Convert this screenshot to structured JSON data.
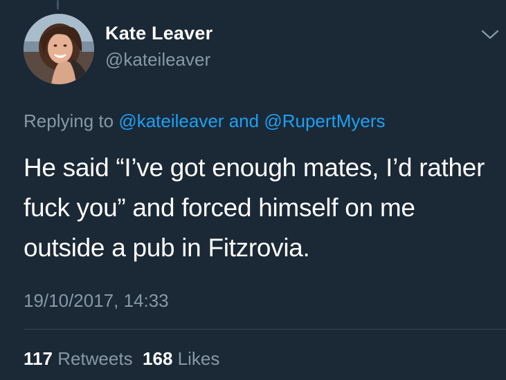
{
  "author": {
    "name": "Kate Leaver",
    "handle": "@kateileaver",
    "avatar_icon": "profile-photo"
  },
  "reply": {
    "prefix": "Replying to",
    "mention_1": "@kateileaver",
    "conjunction": "and",
    "mention_2": "@RupertMyers"
  },
  "tweet": {
    "text": "He said “I’ve got enough mates, I’d rather fuck you” and forced himself on me outside a pub in Fitzrovia.",
    "timestamp": "19/10/2017, 14:33"
  },
  "stats": {
    "retweets_count": "117",
    "retweets_label": "Retweets",
    "likes_count": "168",
    "likes_label": "Likes"
  },
  "colors": {
    "background": "#1b2836",
    "text": "#ffffff",
    "secondary": "#8899a6",
    "link": "#1da1f2",
    "divider": "#38444d"
  },
  "icons": {
    "menu": "chevron-down-icon"
  }
}
